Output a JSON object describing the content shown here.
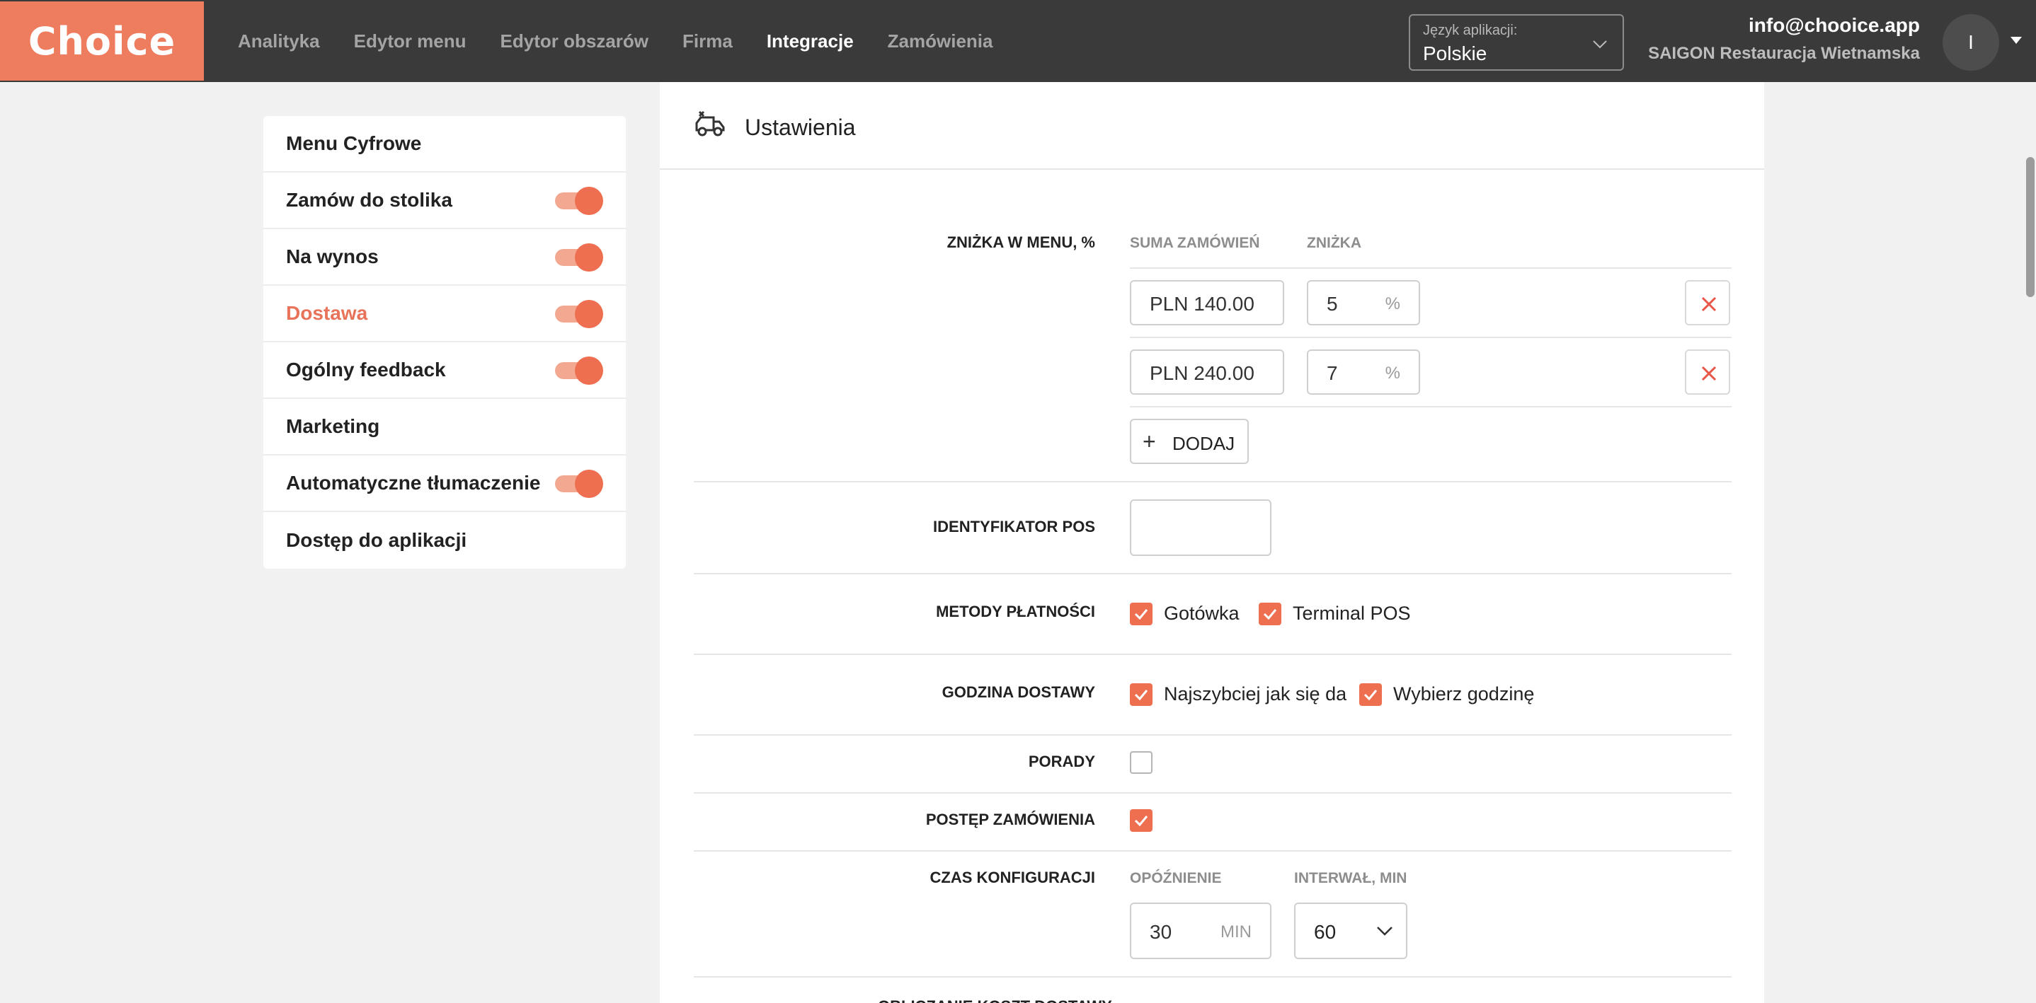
{
  "header": {
    "brand": "Choice",
    "nav": [
      {
        "label": "Analityka",
        "active": false
      },
      {
        "label": "Edytor menu",
        "active": false
      },
      {
        "label": "Edytor obszarów",
        "active": false
      },
      {
        "label": "Firma",
        "active": false
      },
      {
        "label": "Integracje",
        "active": true
      },
      {
        "label": "Zamówienia",
        "active": false
      }
    ],
    "language": {
      "label": "Język aplikacji:",
      "value": "Polskie"
    },
    "user": {
      "email": "info@chooice.app",
      "restaurant": "SAIGON Restauracja Wietnamska",
      "avatar_initial": "I"
    }
  },
  "sidebar": {
    "items": [
      {
        "label": "Menu Cyfrowe",
        "toggle": null,
        "active": false
      },
      {
        "label": "Zamów do stolika",
        "toggle": true,
        "active": false
      },
      {
        "label": "Na wynos",
        "toggle": true,
        "active": false
      },
      {
        "label": "Dostawa",
        "toggle": true,
        "active": true
      },
      {
        "label": "Ogólny feedback",
        "toggle": true,
        "active": false
      },
      {
        "label": "Marketing",
        "toggle": null,
        "active": false
      },
      {
        "label": "Automatyczne tłumaczenie",
        "toggle": true,
        "active": false
      },
      {
        "label": "Dostęp do aplikacji",
        "toggle": null,
        "active": false
      }
    ]
  },
  "settings": {
    "title": "Ustawienia",
    "discount": {
      "label": "ZNIŻKA W MENU, %",
      "col_sum": "SUMA ZAMÓWIEŃ",
      "col_discount": "ZNIŻKA",
      "rows": [
        {
          "sum": "PLN 140.00",
          "discount": "5",
          "unit": "%"
        },
        {
          "sum": "PLN 240.00",
          "discount": "7",
          "unit": "%"
        }
      ],
      "add_label": "DODAJ"
    },
    "pos_id": {
      "label": "IDENTYFIKATOR POS",
      "value": ""
    },
    "payment_methods": {
      "label": "METODY PŁATNOŚCI",
      "options": [
        {
          "label": "Gotówka",
          "checked": true
        },
        {
          "label": "Terminal POS",
          "checked": true
        }
      ]
    },
    "delivery_time": {
      "label": "GODZINA DOSTAWY",
      "options": [
        {
          "label": "Najszybciej jak się da",
          "checked": true
        },
        {
          "label": "Wybierz godzinę",
          "checked": true
        }
      ]
    },
    "tips": {
      "label": "PORADY",
      "checked": false
    },
    "order_progress": {
      "label": "POSTĘP ZAMÓWIENIA",
      "checked": true
    },
    "config_time": {
      "label": "CZAS KONFIGURACJI",
      "delay_label": "OPÓŹNIENIE",
      "delay_value": "30",
      "delay_unit": "MIN",
      "interval_label": "INTERWAŁ, MIN",
      "interval_value": "60"
    },
    "partial_next_label": "OBLICZANIE KOSZT DOSTAWY"
  },
  "colors": {
    "accent": "#ee6f4f",
    "header_bg": "#3a3a3a",
    "page_bg": "#f1f1f1"
  }
}
